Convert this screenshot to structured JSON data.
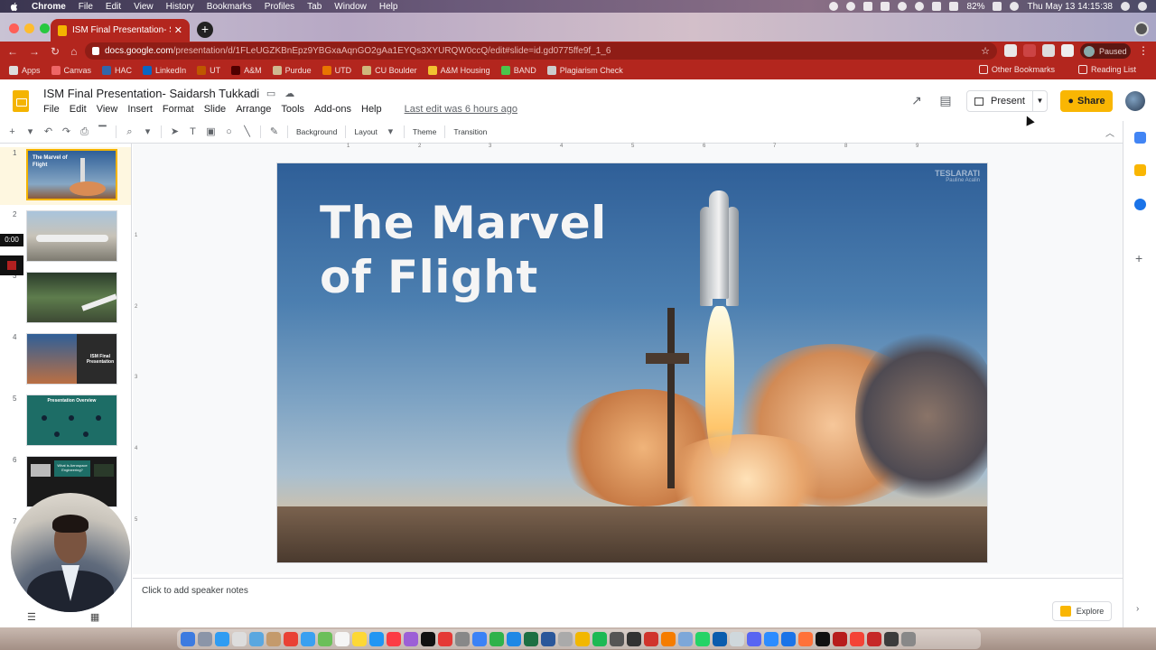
{
  "mac_menubar": {
    "items": [
      "Chrome",
      "File",
      "Edit",
      "View",
      "History",
      "Bookmarks",
      "Profiles",
      "Tab",
      "Window",
      "Help"
    ],
    "battery": "82%",
    "clock": "Thu May 13  14:15:38"
  },
  "browser": {
    "tab_title": "ISM Final Presentation- Saidarsh",
    "url_host": "docs.google.com",
    "url_path": "/presentation/d/1FLeUGZKBnEpz9YBGxaAqnGO2gAa1EYQs3XYURQW0ccQ/edit#slide=id.gd0775ffe9f_1_6",
    "profile_status": "Paused",
    "accent_color": "#b3261e",
    "bookmarks": [
      "Apps",
      "Canvas",
      "HAC",
      "LinkedIn",
      "UT",
      "A&M",
      "Purdue",
      "UTD",
      "CU Boulder",
      "A&M Housing",
      "BAND",
      "Plagiarism Check"
    ],
    "other_bookmarks": "Other Bookmarks",
    "reading_list": "Reading List"
  },
  "slides_app": {
    "doc_title": "ISM Final Presentation- Saidarsh Tukkadi",
    "menu": [
      "File",
      "Edit",
      "View",
      "Insert",
      "Format",
      "Slide",
      "Arrange",
      "Tools",
      "Add-ons",
      "Help"
    ],
    "last_edit": "Last edit was 6 hours ago",
    "present_label": "Present",
    "share_label": "Share",
    "share_color": "#f9b603"
  },
  "toolbar": {
    "background_label": "Background",
    "layout_label": "Layout",
    "theme_label": "Theme",
    "transition_label": "Transition"
  },
  "filmstrip": {
    "slide_numbers": [
      "1",
      "2",
      "3",
      "4",
      "5",
      "6",
      "7"
    ],
    "thumb_texts": {
      "s1": "The Marvel of Flight",
      "s4": "ISM Final Presentation",
      "s5": "Presentation Overview",
      "s6": "What is Aerospace Engineering?"
    },
    "timer": "0:00"
  },
  "ruler": {
    "h_ticks": [
      "1",
      "2",
      "3",
      "4",
      "5",
      "6",
      "7",
      "8",
      "9"
    ],
    "v_ticks": [
      "1",
      "2",
      "3",
      "4",
      "5"
    ]
  },
  "slide": {
    "title_line1": "The Marvel",
    "title_line2": "of Flight",
    "watermark": "TESLARATI",
    "watermark_sub": "Pauline Acalin"
  },
  "notes_placeholder": "Click to add speaker notes",
  "explore_label": "Explore"
}
